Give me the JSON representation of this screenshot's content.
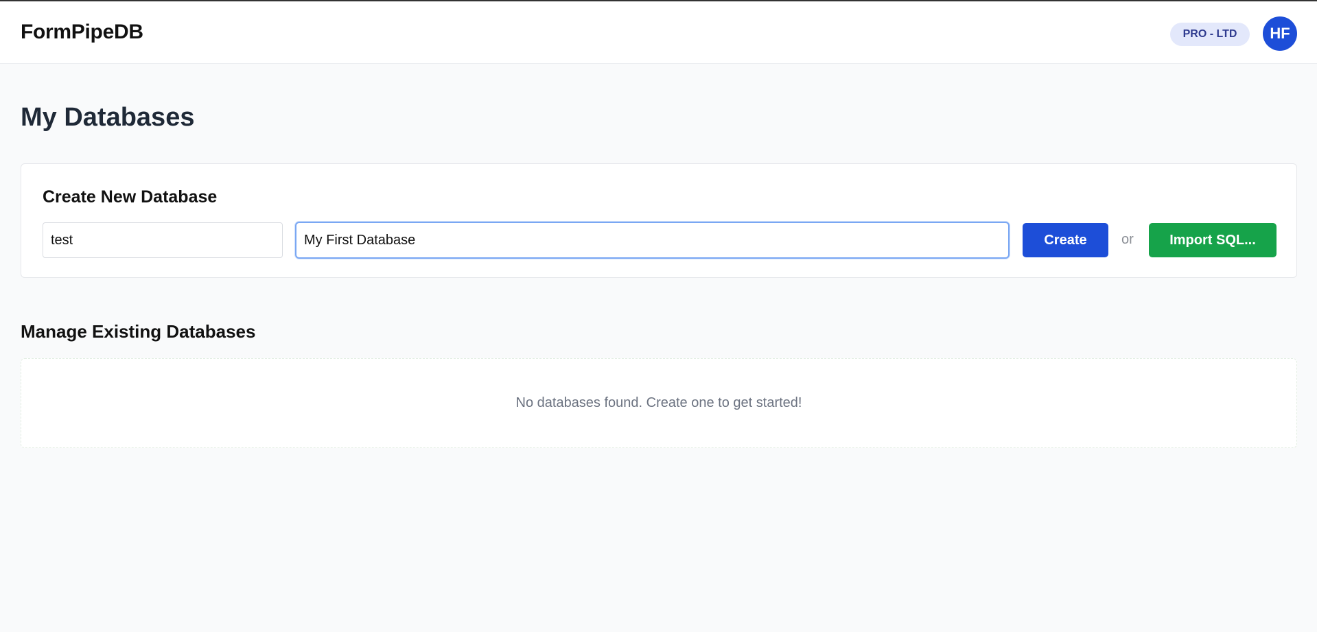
{
  "app": {
    "brand": "FormPipeDB",
    "plan_badge": "PRO - LTD",
    "avatar_initials": "HF"
  },
  "page": {
    "title": "My Databases"
  },
  "create_section": {
    "title": "Create New Database",
    "key_input_value": "test",
    "name_input_value": "My First Database",
    "create_label": "Create",
    "or_label": "or",
    "import_label": "Import SQL..."
  },
  "manage_section": {
    "title": "Manage Existing Databases",
    "empty_message": "No databases found. Create one to get started!"
  },
  "colors": {
    "primary": "#1d4ed8",
    "success": "#16a34a",
    "badge_bg": "#e3e8fb",
    "badge_text": "#2f3b8f",
    "focus_ring": "#7aa7f3"
  }
}
